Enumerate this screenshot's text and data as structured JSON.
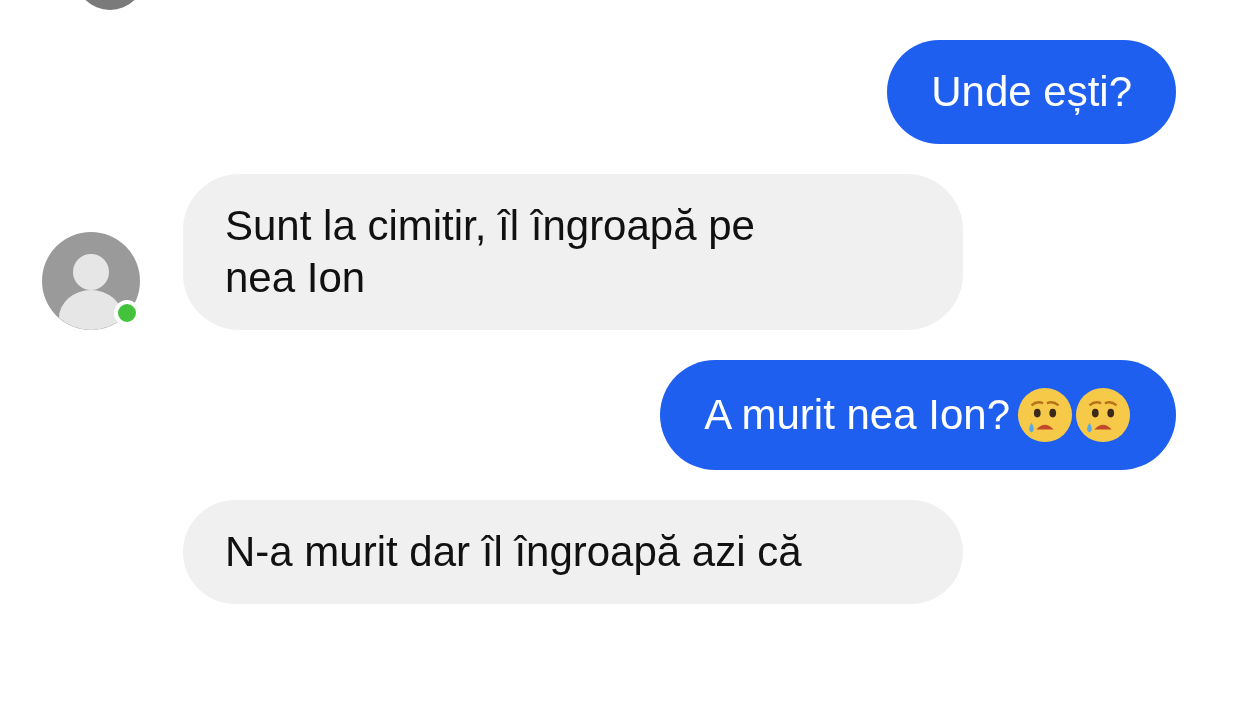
{
  "previous_avatar": {
    "visible": true
  },
  "messages": [
    {
      "kind": "sent",
      "text": "Unde ești?",
      "has_emoji": false
    },
    {
      "kind": "received",
      "lines": [
        "Sunt la cimitir, îl îngroapă pe",
        "nea Ion"
      ],
      "avatar": {
        "online": true
      }
    },
    {
      "kind": "sent",
      "text": "A murit nea Ion?",
      "has_emoji": true
    },
    {
      "kind": "received",
      "lines": [
        "N-a murit dar îl îngroapă azi că"
      ]
    }
  ]
}
